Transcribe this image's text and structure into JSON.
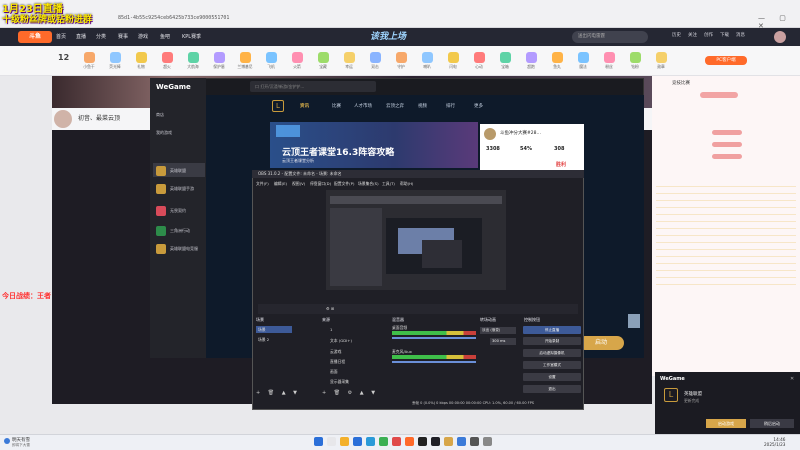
{
  "overlay": {
    "line1": "1月23日直播",
    "line2": "十级粉丝牌或钻粉进群",
    "line3": "今日战绩：王者"
  },
  "browser": {
    "url": "85d1​-4b55c9254ceb6425b733ce9000551701",
    "controls": "— ▢ ✕"
  },
  "douyu": {
    "logo": "斗鱼",
    "nav": [
      "首页",
      "直播",
      "分类",
      "赛事",
      "游戏",
      "鱼吧",
      "KPL赛季"
    ],
    "banner": "该我上场",
    "search_placeholder": "送出闪电雷霆",
    "user_links": [
      "历史",
      "关注",
      "创作",
      "下载",
      "消息"
    ]
  },
  "gift_row": {
    "level": "12",
    "items": [
      "小鱼干",
      "荧光棒",
      "礼物",
      "超火",
      "大航海",
      "保护盾",
      "兰博基尼",
      "飞机",
      "火箭",
      "宝藏",
      "幸运",
      "双击",
      "守护",
      "喇叭",
      "闪电",
      "心动",
      "宝箱",
      "超跑",
      "鱼丸",
      "魔法",
      "粉丝",
      "钻粉",
      "勋章"
    ]
  },
  "streamer": {
    "name": "初音、最菜云顶",
    "right_badge": "PC客户端",
    "right_title": "竞技比赛"
  },
  "wegame": {
    "brand": "WeGame",
    "sidebar": [
      "商店",
      "我的游戏",
      "英雄联盟",
      "英雄联盟手游",
      "无畏契约",
      "三角洲行动",
      "英雄联盟电竞服"
    ],
    "search_placeholder": "口 打开/沉浸/新游/金铲铲…",
    "tabs": [
      "资讯",
      "比赛",
      "人才市场",
      "云顶之弈",
      "视频",
      "排行",
      "更多"
    ],
    "hero_title": "云顶王者课堂16.3阵容攻略",
    "hero_sub": "云顶王者课堂分析",
    "card_title": "斗鱼冲分大赛#28…",
    "card_stats": [
      "3308",
      "54%",
      "308"
    ],
    "card_result": "胜利",
    "launch_label": "启动"
  },
  "obs": {
    "title": "OBS 31.0.2 - 配置文件: 未命名 - 场景: 未命名",
    "menu": [
      "文件(F)",
      "编辑(E)",
      "视图(V)",
      "停靠窗口(D)",
      "配置文件(P)",
      "场景集合(S)",
      "工具(T)",
      "帮助(H)"
    ],
    "panels": [
      "场景",
      "来源",
      "混音器",
      "转场动画",
      "控制按钮"
    ],
    "scenes": [
      "场景",
      "场景 2"
    ],
    "sources": [
      "1",
      "文本 (GDI+)",
      "云游戏",
      "直播日程",
      "画面",
      "显示器采集"
    ],
    "mixer": [
      "桌面音频",
      "麦克风/Aux"
    ],
    "transition": "淡出 (渐变)",
    "duration": "300 ms",
    "controls": [
      "停止直播",
      "开始录制",
      "启动虚拟摄像机",
      "工作室模式",
      "设置",
      "退出"
    ],
    "status": "丢帧 0 (0.0%)   0 kbps   00:00:00   00:00:00   CPU: 1.0%, 60.00 / 60.00 FPS"
  },
  "notify": {
    "brand": "WeGame",
    "game": "英雄联盟",
    "sub": "更新完成",
    "btn_launch": "启动游戏",
    "btn_close": "稍后启动"
  },
  "taskbar": {
    "weather": "明天有雪",
    "weather_sub": "即将下大雪",
    "time": "14:46",
    "date": "2025/1/23"
  }
}
